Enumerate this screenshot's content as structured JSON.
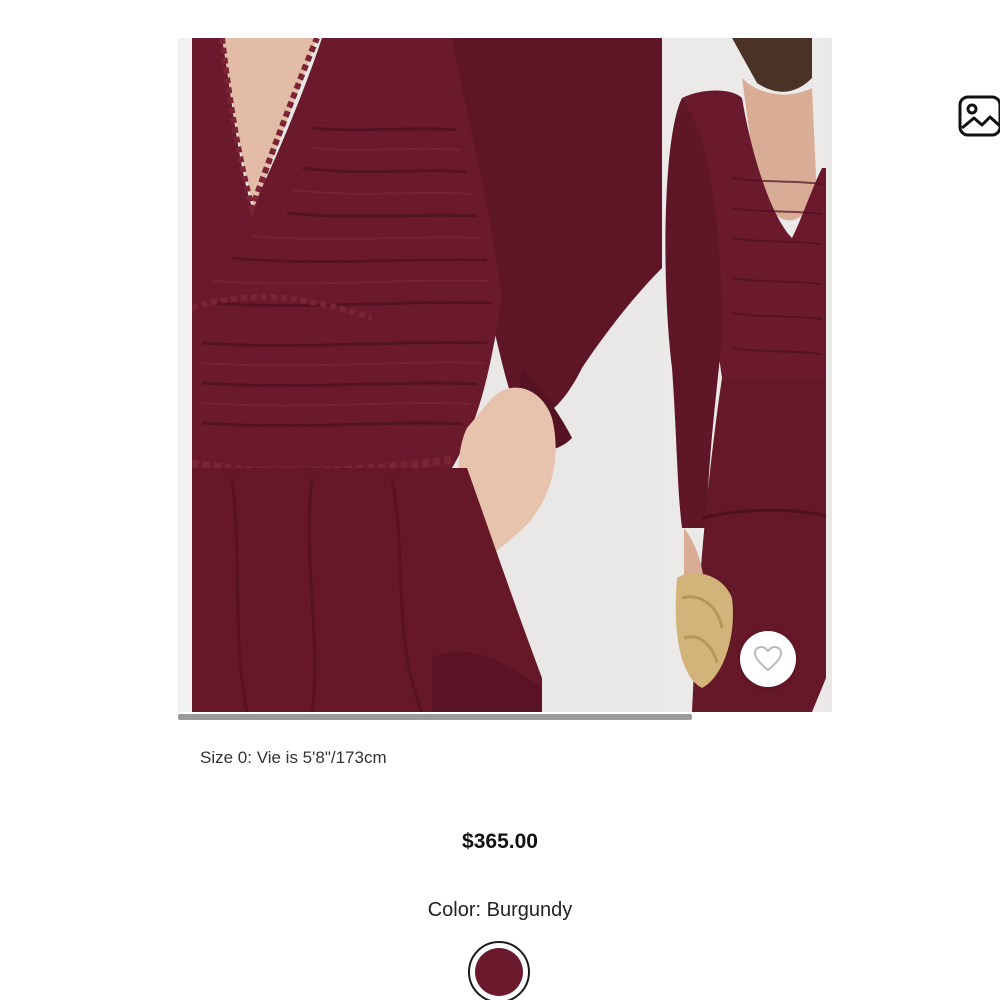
{
  "product": {
    "size_note": "Size 0: Vie is 5'8\"/173cm",
    "price": "$365.00",
    "color_label": "Color: Burgundy",
    "color_hex": "#6a1a2c"
  },
  "gallery": {
    "main_image_icon": "dress-front-closeup",
    "thumb_image_icon": "dress-full-model",
    "wishlist_icon": "heart-outline-icon",
    "view_image_icon": "image-icon"
  },
  "colors": {
    "dress": "#6a1a2c",
    "dress_shadow": "#4e0f1f",
    "dress_highlight": "#7c2a3c",
    "skin": "#e7c3ad",
    "background": "#e9e8e6"
  }
}
